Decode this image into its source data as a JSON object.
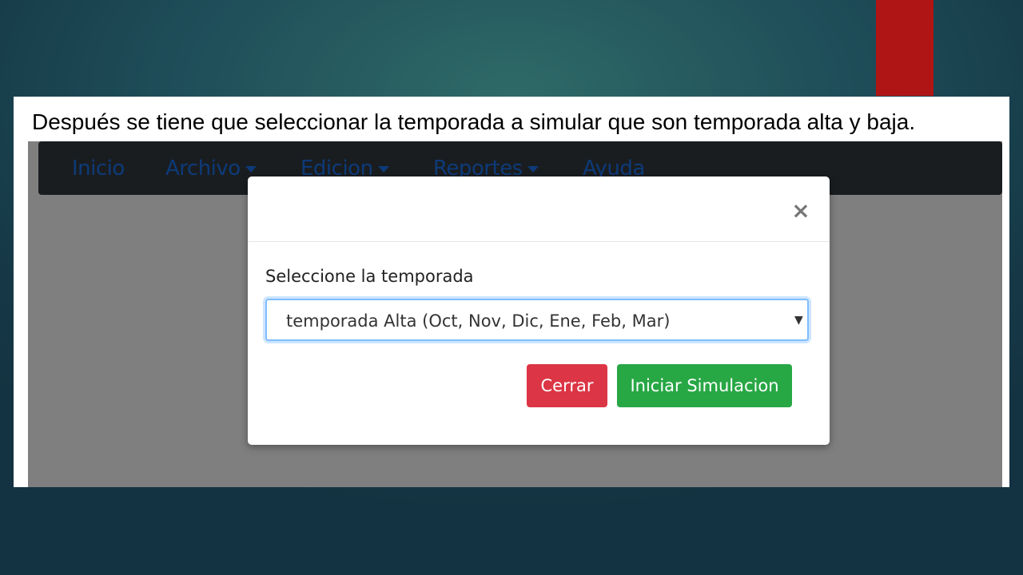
{
  "slide": {
    "caption": "Después se tiene que seleccionar la temporada a simular que son temporada alta y baja."
  },
  "colors": {
    "accent_bar": "#b01515",
    "nav_link": "#1a74f0",
    "btn_close": "#dc3545",
    "btn_start": "#28a745"
  },
  "navbar": {
    "items": [
      {
        "label": "Inicio",
        "dropdown": false
      },
      {
        "label": "Archivo",
        "dropdown": true
      },
      {
        "label": "Edicion",
        "dropdown": true
      },
      {
        "label": "Reportes",
        "dropdown": true
      },
      {
        "label": "Ayuda",
        "dropdown": false
      }
    ]
  },
  "modal": {
    "close_symbol": "×",
    "label": "Seleccione la temporada",
    "select": {
      "selected": "temporada Alta (Oct, Nov, Dic, Ene, Feb, Mar)",
      "arrow": "▼"
    },
    "buttons": {
      "close": "Cerrar",
      "start": "Iniciar Simulacion"
    }
  }
}
